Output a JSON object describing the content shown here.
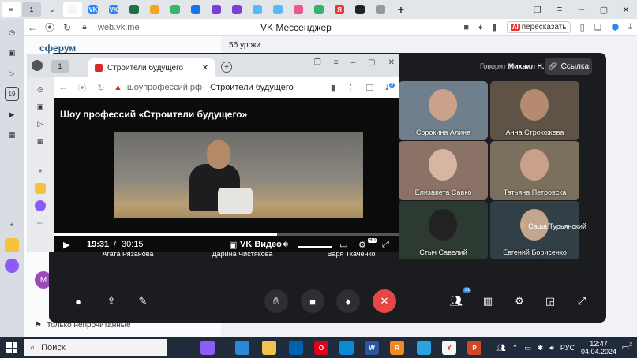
{
  "outer_browser": {
    "tab_count": "1",
    "url": "web.vk.me",
    "title": "VK Мессенджер",
    "retell_label": "пересказать",
    "retell_badge": "AI",
    "tab_icons": [
      {
        "name": "tab-yandex-icon",
        "color": "#f5f6f8",
        "label": ""
      },
      {
        "name": "tab-vk-icon",
        "color": "#2787f5",
        "label": "VK"
      },
      {
        "name": "tab-vk2-icon",
        "color": "#2787f5",
        "label": "VK"
      },
      {
        "name": "tab-excel-icon",
        "color": "#1e7145",
        "label": ""
      },
      {
        "name": "tab-mail-icon",
        "color": "#f5a623",
        "label": ""
      },
      {
        "name": "tab-green-icon",
        "color": "#3bb36c",
        "label": ""
      },
      {
        "name": "tab-blue-icon",
        "color": "#1a73e8",
        "label": ""
      },
      {
        "name": "tab-purple-icon",
        "color": "#7b3fd6",
        "label": ""
      },
      {
        "name": "tab-purple2-icon",
        "color": "#7b3fd6",
        "label": ""
      },
      {
        "name": "tab-heart-icon",
        "color": "#58b9f5",
        "label": ""
      },
      {
        "name": "tab-heart2-icon",
        "color": "#58b9f5",
        "label": ""
      },
      {
        "name": "tab-pink-icon",
        "color": "#e95b8a",
        "label": ""
      },
      {
        "name": "tab-green2-icon",
        "color": "#39b06c",
        "label": ""
      },
      {
        "name": "tab-yandex-red-icon",
        "color": "#e33",
        "label": "Я"
      },
      {
        "name": "tab-black-icon",
        "color": "#222",
        "label": ""
      },
      {
        "name": "tab-doc-icon",
        "color": "#999",
        "label": ""
      }
    ]
  },
  "vk": {
    "logo": "сферум",
    "chat_name": "5б уроки",
    "only_unread": "Только непрочитанные",
    "avatar_letter": "М"
  },
  "call": {
    "speaker_prefix": "Говорит",
    "speaker_name": "Михаил Н.",
    "link_label": "Ссылка",
    "participants_badge": "31",
    "tiles": [
      {
        "name": "Сорокина Алина",
        "bg": "#6f7f8c",
        "face": "#caa28c"
      },
      {
        "name": "Анна Строкожева",
        "bg": "#5f5346",
        "face": "#b58a70"
      },
      {
        "name": "Елизавета Савко",
        "bg": "#8a7266",
        "face": "#d8b4a2"
      },
      {
        "name": "Татьяна Петровска",
        "bg": "#7b6f5e",
        "face": "#c9a088"
      },
      {
        "name": "Стыч Савелий",
        "bg": "#2c3a32",
        "face": "#222222"
      },
      {
        "name": "Евгений Борисенко",
        "bg": "#333f47",
        "face": "#c4a68e"
      }
    ],
    "bottom_labels": [
      "Агата Рязанова",
      "Дарина Чистякова",
      "Варя Ткаченко"
    ],
    "hand_label": "Саша Турьянский"
  },
  "inner_browser": {
    "tab_count": "1",
    "tab_title": "Строители будущего",
    "domain": "шоупрофессий.рф",
    "page_title": "Строители будущего",
    "download_badge": "3"
  },
  "video": {
    "title": "Шоу профессий «Строители будущего»",
    "current_time": "19:31",
    "separator": "/",
    "duration": "30:15",
    "brand": "VK Видео",
    "hd_badge": "HD",
    "progress_fraction": 0.645
  },
  "taskbar": {
    "search_placeholder": "Поиск",
    "language": "РУС",
    "time": "12:47",
    "date": "04.04.2024",
    "notif_count": "2",
    "apps": [
      {
        "name": "task-view-icon",
        "color": "#1f2a3a",
        "label": ""
      },
      {
        "name": "alice-icon",
        "color": "#8b5cf6",
        "label": ""
      },
      {
        "name": "monitor-icon",
        "color": "#2b89d8",
        "label": ""
      },
      {
        "name": "explorer-icon",
        "color": "#f2c14e",
        "label": ""
      },
      {
        "name": "store-icon",
        "color": "#0063b1",
        "label": ""
      },
      {
        "name": "opera-icon",
        "color": "#e0001b",
        "label": "O"
      },
      {
        "name": "edge-icon",
        "color": "#0b8bd6",
        "label": ""
      },
      {
        "name": "word-icon",
        "color": "#2b579a",
        "label": "W"
      },
      {
        "name": "reader-icon",
        "color": "#f08a24",
        "label": "R"
      },
      {
        "name": "telegram-icon",
        "color": "#2aa3df",
        "label": ""
      },
      {
        "name": "yandex-browser-icon",
        "color": "#f5f5f5",
        "label": "Y"
      },
      {
        "name": "powerpoint-icon",
        "color": "#d24726",
        "label": "P"
      }
    ]
  }
}
